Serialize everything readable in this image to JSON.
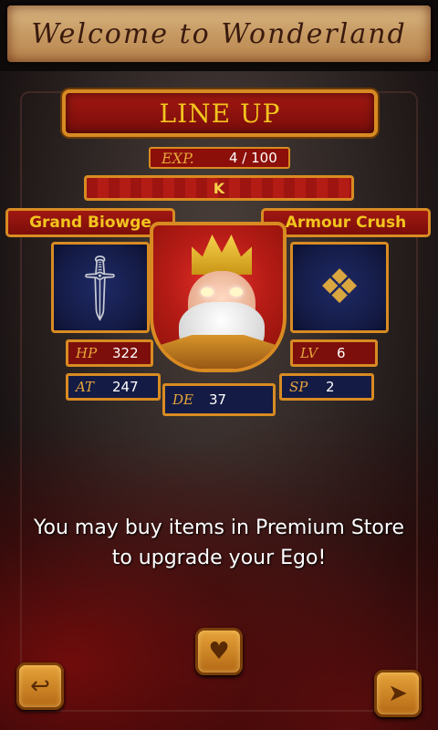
{
  "header": {
    "title": "Welcome to Wonderland"
  },
  "lineup": {
    "title": "LINE UP"
  },
  "exp": {
    "label": "EXP.",
    "value": "4 / 100"
  },
  "character": {
    "name": "K"
  },
  "items": {
    "weapon": {
      "name": "Grand Biowge",
      "icon": "sword-icon"
    },
    "armour": {
      "name": "Armour Crush",
      "icon": "armour-icon"
    }
  },
  "stats": {
    "hp": {
      "label": "HP",
      "value": "322"
    },
    "at": {
      "label": "AT",
      "value": "247"
    },
    "de": {
      "label": "DE",
      "value": "37"
    },
    "lv": {
      "label": "LV",
      "value": "6"
    },
    "sp": {
      "label": "SP",
      "value": "2"
    }
  },
  "message": {
    "line1": "You may buy items in Premium Store",
    "line2": "to upgrade your Ego!"
  },
  "buttons": {
    "back": {
      "icon": "back-arrow-icon"
    },
    "store": {
      "icon": "cart-heart-icon"
    },
    "next": {
      "icon": "next-icon"
    }
  },
  "colors": {
    "gold_border": "#d88b22",
    "plaque_red": "#a11812",
    "slot_blue": "#141b45",
    "label_gold": "#f2c41e"
  }
}
